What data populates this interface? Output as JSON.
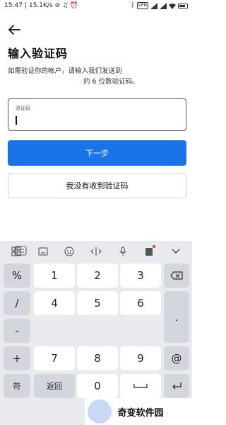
{
  "status_bar": {
    "time": "15:47",
    "speed": "15.1K/s",
    "left_icons": [
      "sync-off-icon",
      "bell-icon",
      "alarm-icon"
    ],
    "vpn": "VPN",
    "right_icons": [
      "bluetooth-icon",
      "signal-icon",
      "signal-icon",
      "wifi-icon",
      "battery-icon"
    ]
  },
  "page": {
    "title": "输入验证码",
    "description_line1": "如需验证你的帐户，请输入我们发送到",
    "description_line2": "的 6 位数验证码。",
    "code_field_label": "验证码",
    "next_button": "下一步",
    "no_code_button": "我没有收到验证码"
  },
  "keyboard": {
    "toolbar_icons": [
      "grid-icon",
      "keyboard-icon",
      "emoji-icon",
      "cursor-icon",
      "microphone-icon",
      "clipboard-icon",
      "collapse-icon"
    ],
    "keys": {
      "percent": "%",
      "slash": "/",
      "minus": "-",
      "plus": "+",
      "fu": "符",
      "k1": "1",
      "k2": "2",
      "k3": "3",
      "k4": "4",
      "k5": "5",
      "k6": "6",
      "k7": "7",
      "k8": "8",
      "k9": "9",
      "k0": "0",
      "back": "返回",
      "dot": ".",
      "at": "@"
    }
  },
  "watermark": "奇变软件园"
}
